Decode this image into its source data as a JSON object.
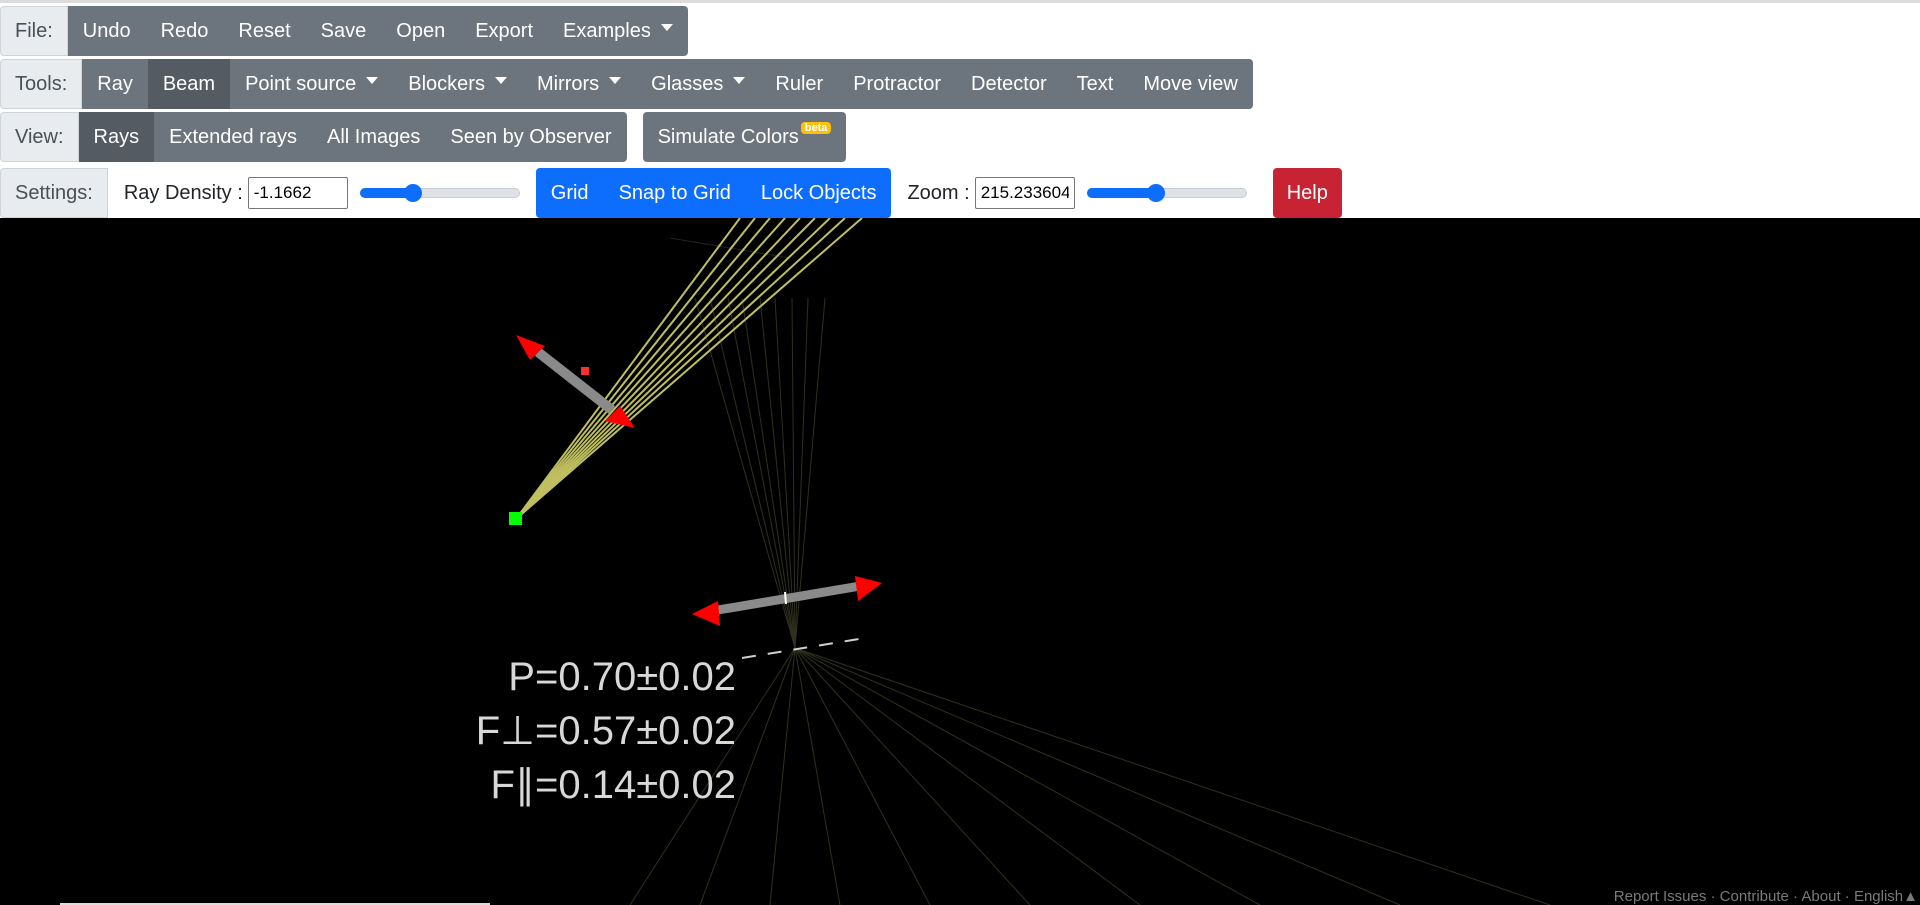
{
  "file": {
    "label": "File:",
    "buttons": [
      "Undo",
      "Redo",
      "Reset",
      "Save",
      "Open",
      "Export",
      "Examples"
    ]
  },
  "tools": {
    "label": "Tools:",
    "buttons": [
      "Ray",
      "Beam",
      "Point source",
      "Blockers",
      "Mirrors",
      "Glasses",
      "Ruler",
      "Protractor",
      "Detector",
      "Text",
      "Move view"
    ],
    "active": "Beam"
  },
  "view": {
    "label": "View:",
    "buttons": [
      "Rays",
      "Extended rays",
      "All Images",
      "Seen by Observer"
    ],
    "active": "Rays",
    "simulate_colors": "Simulate Colors",
    "beta_badge": "beta"
  },
  "settings": {
    "label": "Settings:",
    "ray_density_label": "Ray Density :",
    "ray_density_value": "-1.1662",
    "ray_density_slider": 0.33,
    "grid": "Grid",
    "snap_to_grid": "Snap to Grid",
    "lock_objects": "Lock Objects",
    "zoom_label": "Zoom :",
    "zoom_value": "215.233604",
    "zoom_slider": 0.43,
    "help": "Help"
  },
  "canvas": {
    "detector_readout": {
      "p": "P=0.70±0.02",
      "f_perp": "F⊥=0.57±0.02",
      "f_par": "F∥=0.14±0.02"
    }
  },
  "footer": {
    "report": "Report Issues",
    "contribute": "Contribute",
    "about": "About",
    "language": "English▲",
    "separator": " · "
  },
  "colors": {
    "ray": "#ffff80",
    "handle_arrow": "#ff0000",
    "point_source": "#00ff00",
    "blue_btn": "#0d6efd",
    "gray_btn": "#6c757d",
    "help_btn": "#c82333"
  }
}
